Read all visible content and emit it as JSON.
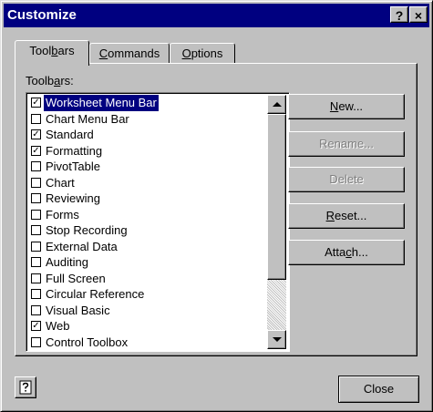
{
  "window": {
    "title": "Customize",
    "help_glyph": "?",
    "close_glyph": "×"
  },
  "tabs": [
    {
      "label_pre": "Tool",
      "label_key": "b",
      "label_post": "ars",
      "active": true
    },
    {
      "label_pre": "",
      "label_key": "C",
      "label_post": "ommands",
      "active": false
    },
    {
      "label_pre": "",
      "label_key": "O",
      "label_post": "ptions",
      "active": false
    }
  ],
  "toolbars_label": {
    "pre": "Toolb",
    "key": "a",
    "post": "rs:"
  },
  "toolbars": [
    {
      "label": "Worksheet Menu Bar",
      "checked": true,
      "selected": true
    },
    {
      "label": "Chart Menu Bar",
      "checked": false
    },
    {
      "label": "Standard",
      "checked": true
    },
    {
      "label": "Formatting",
      "checked": true
    },
    {
      "label": "PivotTable",
      "checked": false
    },
    {
      "label": "Chart",
      "checked": false
    },
    {
      "label": "Reviewing",
      "checked": false
    },
    {
      "label": "Forms",
      "checked": false
    },
    {
      "label": "Stop Recording",
      "checked": false
    },
    {
      "label": "External Data",
      "checked": false
    },
    {
      "label": "Auditing",
      "checked": false
    },
    {
      "label": "Full Screen",
      "checked": false
    },
    {
      "label": "Circular Reference",
      "checked": false
    },
    {
      "label": "Visual Basic",
      "checked": false
    },
    {
      "label": "Web",
      "checked": true
    },
    {
      "label": "Control Toolbox",
      "checked": false
    }
  ],
  "buttons": {
    "new": {
      "pre": "",
      "key": "N",
      "post": "ew..."
    },
    "rename": {
      "label": "Rename..."
    },
    "delete": {
      "label": "Delete"
    },
    "reset": {
      "pre": "",
      "key": "R",
      "post": "eset..."
    },
    "attach": {
      "pre": "Atta",
      "key": "c",
      "post": "h..."
    },
    "close": {
      "label": "Close"
    }
  },
  "colors": {
    "face": "#c0c0c0",
    "titlebar": "#000080",
    "selection": "#000080"
  }
}
